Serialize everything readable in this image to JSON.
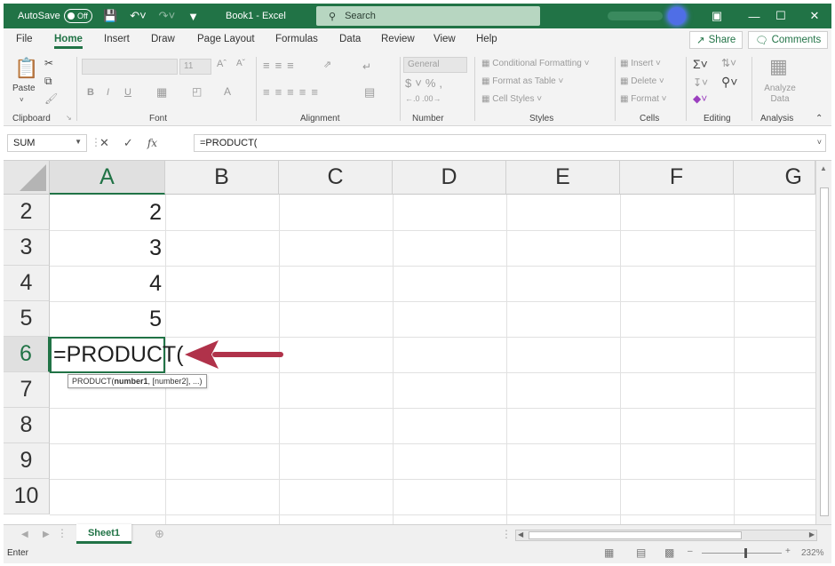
{
  "titlebar": {
    "autosave_label": "AutoSave",
    "autosave_state": "Off",
    "doc_title": "Book1 - Excel",
    "search_placeholder": "Search"
  },
  "menu_tabs": [
    "File",
    "Home",
    "Insert",
    "Draw",
    "Page Layout",
    "Formulas",
    "Data",
    "Review",
    "View",
    "Help"
  ],
  "active_tab": "Home",
  "share_label": "Share",
  "comments_label": "Comments",
  "ribbon": {
    "groups": [
      "Clipboard",
      "Font",
      "Alignment",
      "Number",
      "Styles",
      "Cells",
      "Editing",
      "Analysis"
    ],
    "paste_label": "Paste",
    "font_size": "11",
    "number_format": "General",
    "conditional_formatting": "Conditional Formatting",
    "format_as_table": "Format as Table",
    "cell_styles": "Cell Styles",
    "insert": "Insert",
    "delete": "Delete",
    "format": "Format",
    "analyze_data": "Analyze Data"
  },
  "formula_bar": {
    "name_box": "SUM",
    "cancel_symbol": "✕",
    "enter_symbol": "✓",
    "fx_symbol": "fx",
    "formula": "=PRODUCT("
  },
  "grid": {
    "columns": [
      "A",
      "B",
      "C",
      "D",
      "E",
      "F",
      "G"
    ],
    "selected_column": "A",
    "rows": [
      "2",
      "3",
      "4",
      "5",
      "6",
      "7",
      "8",
      "9",
      "10"
    ],
    "selected_row": "6",
    "values_col_a": [
      "2",
      "3",
      "4",
      "5"
    ],
    "active_cell_text": "=PRODUCT(",
    "tooltip": {
      "prefix": "PRODUCT(",
      "bold_arg": "number1",
      "rest": ", [number2], ...)"
    }
  },
  "sheet_tabs": [
    "Sheet1"
  ],
  "status": {
    "mode": "Enter",
    "zoom": "232%"
  },
  "colors": {
    "accent": "#217346",
    "arrow": "#b0324a"
  }
}
